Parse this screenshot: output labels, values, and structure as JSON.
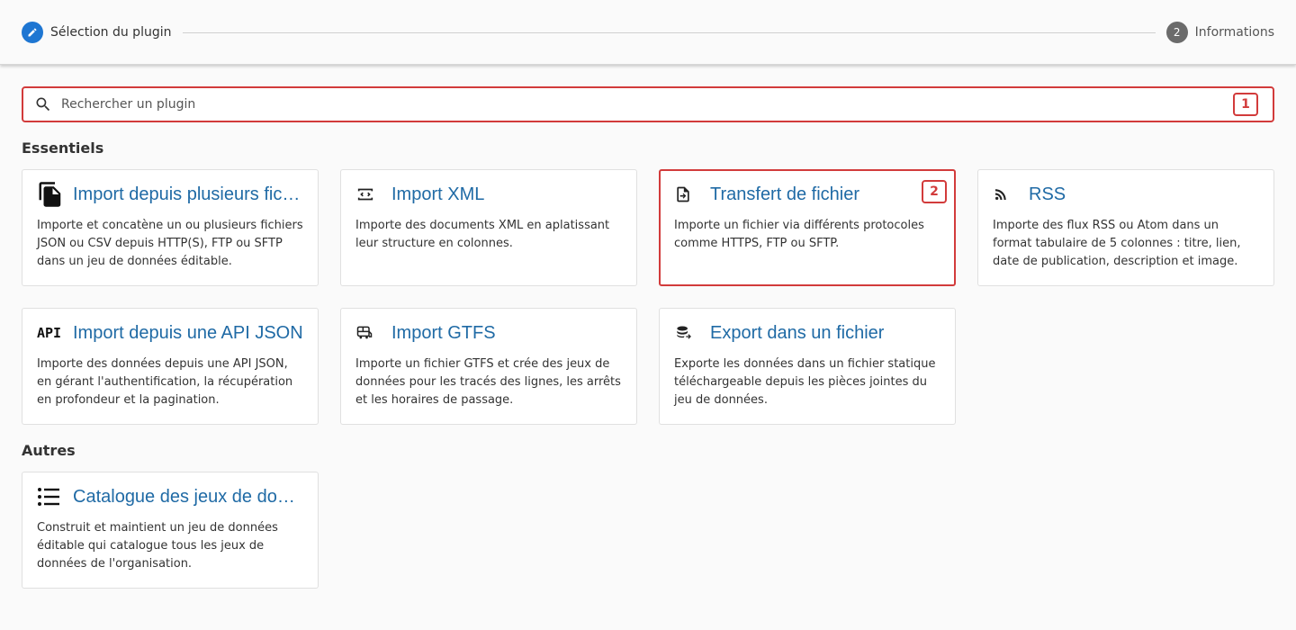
{
  "stepper": {
    "step1": {
      "icon": "pencil-icon",
      "label": "Sélection du plugin"
    },
    "step2": {
      "number": "2",
      "label": "Informations"
    }
  },
  "search": {
    "placeholder": "Rechercher un plugin",
    "badge": "1"
  },
  "sections": {
    "essentiels": "Essentiels",
    "autres": "Autres"
  },
  "cards": [
    {
      "icon": "file-copy-icon",
      "title": "Import depuis plusieurs fichiers",
      "desc": "Importe et concatène un ou plusieurs fichiers JSON ou CSV depuis HTTP(S), FTP ou SFTP dans un jeu de données éditable."
    },
    {
      "icon": "xml-icon",
      "title": "Import XML",
      "desc": "Importe des documents XML en aplatissant leur structure en colonnes."
    },
    {
      "icon": "file-transfer-icon",
      "title": "Transfert de fichier",
      "desc": "Importe un fichier via différents protocoles comme HTTPS, FTP ou SFTP.",
      "badge": "2"
    },
    {
      "icon": "rss-icon",
      "title": "RSS",
      "desc": "Importe des flux RSS ou Atom dans un format tabulaire de 5 colonnes : titre, lien, date de publication, description et image."
    },
    {
      "icon": "api-icon",
      "icon_text": "API",
      "title": "Import depuis une API JSON",
      "desc": "Importe des données depuis une API JSON, en gérant l'authentification, la récupération en profondeur et la pagination."
    },
    {
      "icon": "bus-icon",
      "title": "Import GTFS",
      "desc": "Importe un fichier GTFS et crée des jeux de données pour les tracés des lignes, les arrêts et les horaires de passage."
    },
    {
      "icon": "database-export-icon",
      "title": "Export dans un fichier",
      "desc": "Exporte les données dans un fichier statique téléchargeable depuis les pièces jointes du jeu de données."
    },
    {
      "icon": "list-icon",
      "title": "Catalogue des jeux de données",
      "desc": "Construit et maintient un jeu de données éditable qui catalogue tous les jeux de données de l'organisation."
    }
  ],
  "colors": {
    "accent": "#1e76d2",
    "title": "#1f6aa5",
    "highlight": "#d23b3b"
  }
}
